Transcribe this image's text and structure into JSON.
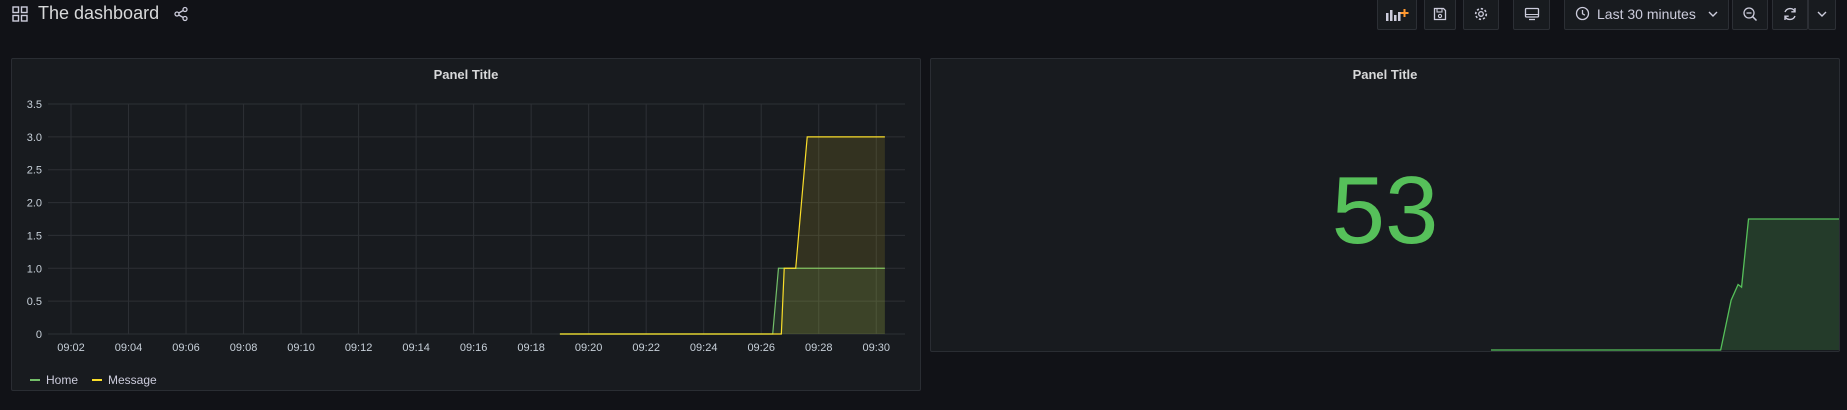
{
  "header": {
    "dashboard_title": "The dashboard",
    "time_range_label": "Last 30 minutes"
  },
  "panels": [
    {
      "title": "Panel Title",
      "type": "graph"
    },
    {
      "title": "Panel Title",
      "type": "stat",
      "value": "53",
      "color": "#56c05a"
    }
  ],
  "chart_data": [
    {
      "type": "line",
      "title": "Panel Title",
      "x_unit": "time",
      "x_ticks": [
        "09:02",
        "09:04",
        "09:06",
        "09:08",
        "09:10",
        "09:12",
        "09:14",
        "09:16",
        "09:18",
        "09:20",
        "09:22",
        "09:24",
        "09:26",
        "09:28",
        "09:30"
      ],
      "y_ticks": [
        "0",
        "0.5",
        "1.0",
        "1.5",
        "2.0",
        "2.5",
        "3.0",
        "3.5"
      ],
      "ylim": [
        0,
        3.5
      ],
      "grid": true,
      "legend_position": "bottom-left",
      "series": [
        {
          "name": "Home",
          "color": "#73bf69",
          "points": [
            [
              "09:19",
              0
            ],
            [
              "09:26.4",
              0
            ],
            [
              "09:26.6",
              1
            ],
            [
              "09:30.3",
              1
            ]
          ]
        },
        {
          "name": "Message",
          "color": "#fade2a",
          "points": [
            [
              "09:19",
              0
            ],
            [
              "09:26.7",
              0
            ],
            [
              "09:26.8",
              1
            ],
            [
              "09:27.2",
              1
            ],
            [
              "09:27.6",
              3
            ],
            [
              "09:30.3",
              3
            ]
          ]
        }
      ]
    },
    {
      "type": "area",
      "title": "Panel Title",
      "sparkline": true,
      "color": "#56c05a",
      "points": [
        [
          0,
          0
        ],
        [
          0.66,
          0
        ],
        [
          0.69,
          0.38
        ],
        [
          0.71,
          0.5
        ],
        [
          0.72,
          0.48
        ],
        [
          0.74,
          1
        ],
        [
          1,
          1
        ]
      ]
    }
  ]
}
